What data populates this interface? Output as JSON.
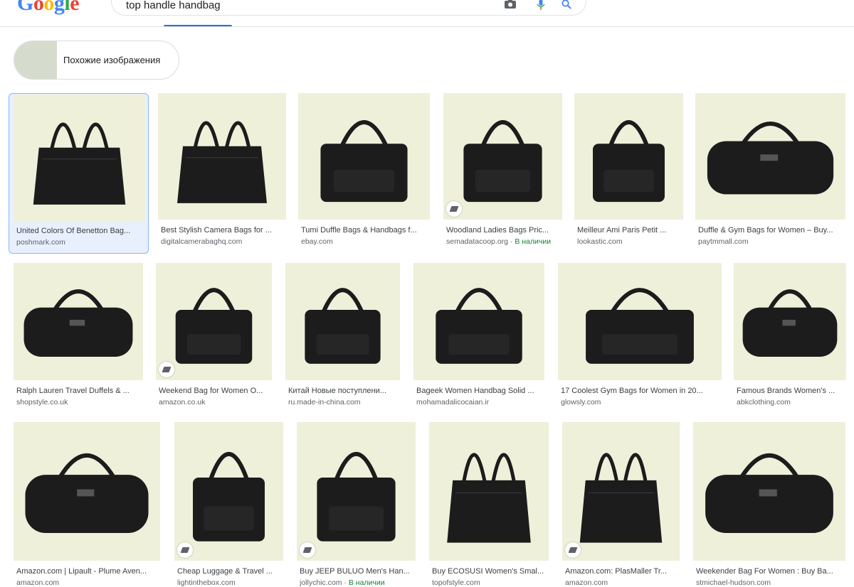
{
  "search": {
    "query": "top handle handbag"
  },
  "chip": {
    "label": "Похожие изображения"
  },
  "results": [
    {
      "title": "United Colors Of Benetton Bag...",
      "source": "poshmark.com",
      "extra": ""
    },
    {
      "title": "Best Stylish Camera Bags for ...",
      "source": "digitalcamerabaghq.com",
      "extra": ""
    },
    {
      "title": "Tumi Duffle Bags & Handbags f...",
      "source": "ebay.com",
      "extra": ""
    },
    {
      "title": "Woodland Ladies Bags Pric...",
      "source": "semadatacoop.org · ",
      "extra": "В наличии"
    },
    {
      "title": "Meilleur Ami Paris Petit ...",
      "source": "lookastic.com",
      "extra": ""
    },
    {
      "title": "Duffle & Gym Bags for Women – Buy...",
      "source": "paytmmall.com",
      "extra": ""
    },
    {
      "title": "Ralph Lauren Travel Duffels & ...",
      "source": "shopstyle.co.uk",
      "extra": ""
    },
    {
      "title": "Weekend Bag for Women O...",
      "source": "amazon.co.uk",
      "extra": ""
    },
    {
      "title": "Китай Новые поступлени...",
      "source": "ru.made-in-china.com",
      "extra": ""
    },
    {
      "title": "Bageek Women Handbag Solid ...",
      "source": "mohamadalicocaian.ir",
      "extra": ""
    },
    {
      "title": "17 Coolest Gym Bags for Women in 20...",
      "source": "glowsly.com",
      "extra": ""
    },
    {
      "title": "Famous Brands Women's ...",
      "source": "abkclothing.com",
      "extra": ""
    },
    {
      "title": "Amazon.com | Lipault - Plume Aven...",
      "source": "amazon.com",
      "extra": ""
    },
    {
      "title": "Cheap Luggage & Travel ...",
      "source": "lightinthebox.com",
      "extra": ""
    },
    {
      "title": "Buy JEEP BULUO Men's Han...",
      "source": "jollychic.com · ",
      "extra": "В наличии"
    },
    {
      "title": "Buy ECOSUSI Women's Smal...",
      "source": "topofstyle.com",
      "extra": ""
    },
    {
      "title": "Amazon.com: PlasMaller Tr...",
      "source": "amazon.com",
      "extra": ""
    },
    {
      "title": "Weekender Bag For Women : Buy Ba...",
      "source": "stmichael-hudson.com",
      "extra": ""
    }
  ],
  "colors": {
    "thumb_bg": "#eef0da",
    "bag": "#1c1c1c",
    "accent_blue": "#1a73e8",
    "in_stock_green": "#188038"
  },
  "icons": [
    "camera-icon",
    "mic-icon",
    "search-icon",
    "tag-icon"
  ]
}
